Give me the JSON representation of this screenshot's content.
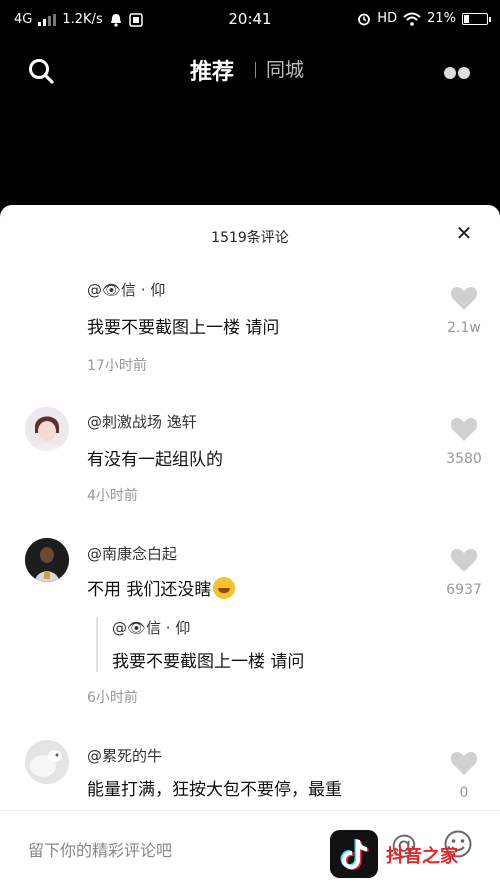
{
  "status_bar": {
    "network": "4G",
    "speed": "1.2K/s",
    "time": "20:41",
    "hd": "HD",
    "battery": "21%",
    "battery_level": 0.21
  },
  "top_nav": {
    "tab_recommend": "推荐",
    "tab_local": "同城"
  },
  "comments_sheet": {
    "title": "1519条评论",
    "comments": [
      {
        "username": "@👁信 · 仰",
        "text": "我要不要截图上一楼 请问",
        "time": "17小时前",
        "likes": "2.1w"
      },
      {
        "username": "@刺激战场 逸轩",
        "text": "有没有一起组队的",
        "time": "4小时前",
        "likes": "3580"
      },
      {
        "username": "@南康念白起",
        "text": "不用 我们还没瞎",
        "time": "6小时前",
        "likes": "6937",
        "reply": {
          "username": "@👁信 · 仰",
          "text": "我要不要截图上一楼 请问"
        }
      },
      {
        "username": "@累死的牛",
        "text": "能量打满，狂按大包不要停，最重",
        "likes": "0"
      }
    ]
  },
  "input_bar": {
    "placeholder": "留下你的精彩评论吧"
  },
  "watermark": {
    "text": "抖音之家"
  },
  "colors": {
    "accent_red": "#e8262a",
    "like_grey": "#d0d0d0",
    "secondary_text": "#999999"
  }
}
